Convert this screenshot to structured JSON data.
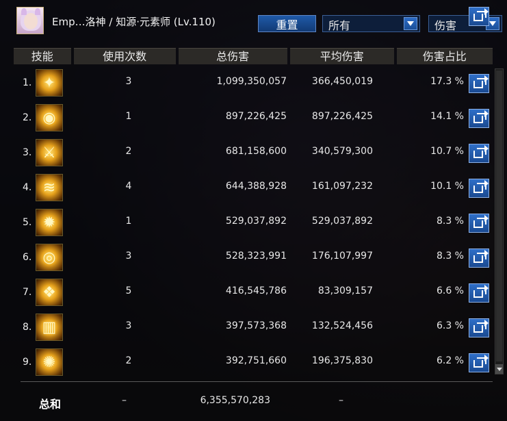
{
  "header": {
    "character_name": "Emp…洛神 / 知源·元素师 (Lv.110)",
    "reset_label": "重置",
    "filter_type": "所有",
    "filter_metric": "伤害"
  },
  "columns": {
    "skill": "技能",
    "uses": "使用次数",
    "total": "总伤害",
    "average": "平均伤害",
    "share": "伤害占比"
  },
  "rows": [
    {
      "index": "1.",
      "icon": "lightning-orb-icon",
      "uses": "3",
      "total": "1,099,350,057",
      "average": "366,450,019",
      "pct": "17.3 %"
    },
    {
      "index": "2.",
      "icon": "magic-dome-icon",
      "uses": "1",
      "total": "897,226,425",
      "average": "897,226,425",
      "pct": "14.1 %"
    },
    {
      "index": "3.",
      "icon": "arcane-swords-icon",
      "uses": "2",
      "total": "681,158,600",
      "average": "340,579,300",
      "pct": "10.7 %"
    },
    {
      "index": "4.",
      "icon": "flame-wave-icon",
      "uses": "4",
      "total": "644,388,928",
      "average": "161,097,232",
      "pct": "10.1 %"
    },
    {
      "index": "5.",
      "icon": "burst-explosion-icon",
      "uses": "1",
      "total": "529,037,892",
      "average": "529,037,892",
      "pct": "8.3 %"
    },
    {
      "index": "6.",
      "icon": "vortex-icon",
      "uses": "3",
      "total": "528,323,991",
      "average": "176,107,997",
      "pct": "8.3 %"
    },
    {
      "index": "7.",
      "icon": "crystal-shards-icon",
      "uses": "5",
      "total": "416,545,786",
      "average": "83,309,157",
      "pct": "6.6 %"
    },
    {
      "index": "8.",
      "icon": "light-pillars-icon",
      "uses": "3",
      "total": "397,573,368",
      "average": "132,524,456",
      "pct": "6.3 %"
    },
    {
      "index": "9.",
      "icon": "fire-ring-icon",
      "uses": "2",
      "total": "392,751,660",
      "average": "196,375,830",
      "pct": "6.2 %"
    }
  ],
  "summary": {
    "label": "总和",
    "uses": "–",
    "total": "6,355,570,283",
    "average": "–"
  },
  "colors": {
    "button_blue": "#1f5aa8",
    "header_bg": "#2c2a27",
    "icon_gold": "#e6a11c"
  }
}
